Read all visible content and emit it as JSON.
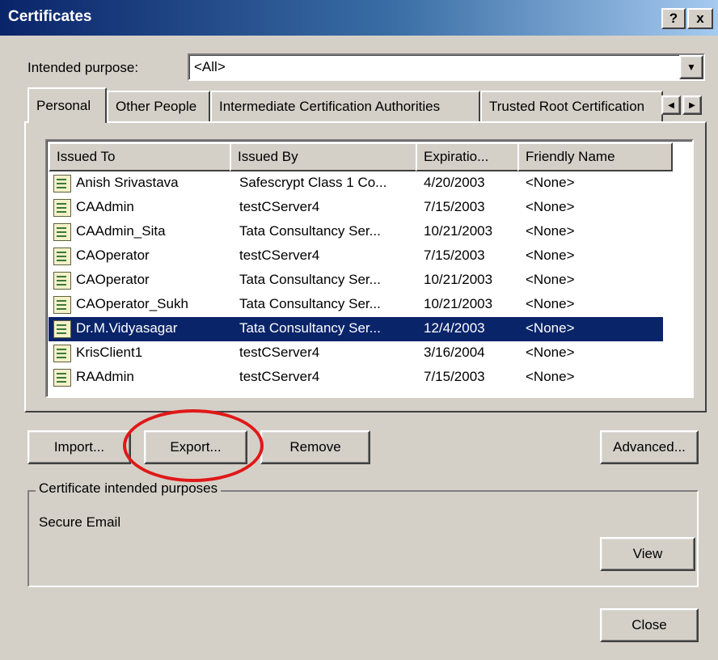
{
  "window": {
    "title": "Certificates",
    "help_button": "?",
    "close_button": "x"
  },
  "purpose": {
    "label": "Intended purpose:",
    "value": "<All>"
  },
  "tabs": [
    {
      "label": "Personal"
    },
    {
      "label": "Other People"
    },
    {
      "label": "Intermediate Certification Authorities"
    },
    {
      "label": "Trusted Root Certification"
    }
  ],
  "list": {
    "columns": [
      "Issued To",
      "Issued By",
      "Expiratio...",
      "Friendly Name"
    ],
    "rows": [
      {
        "issued_to": "Anish Srivastava",
        "issued_by": "Safescrypt Class 1 Co...",
        "expiration": "4/20/2003",
        "friendly_name": "<None>"
      },
      {
        "issued_to": "CAAdmin",
        "issued_by": "testCServer4",
        "expiration": "7/15/2003",
        "friendly_name": "<None>"
      },
      {
        "issued_to": "CAAdmin_Sita",
        "issued_by": "Tata Consultancy Ser...",
        "expiration": "10/21/2003",
        "friendly_name": "<None>"
      },
      {
        "issued_to": "CAOperator",
        "issued_by": "testCServer4",
        "expiration": "7/15/2003",
        "friendly_name": "<None>"
      },
      {
        "issued_to": "CAOperator",
        "issued_by": "Tata Consultancy Ser...",
        "expiration": "10/21/2003",
        "friendly_name": "<None>"
      },
      {
        "issued_to": "CAOperator_Sukh",
        "issued_by": "Tata Consultancy Ser...",
        "expiration": "10/21/2003",
        "friendly_name": "<None>"
      },
      {
        "issued_to": "Dr.M.Vidyasagar",
        "issued_by": "Tata Consultancy Ser...",
        "expiration": "12/4/2003",
        "friendly_name": "<None>",
        "selected": true
      },
      {
        "issued_to": "KrisClient1",
        "issued_by": "testCServer4",
        "expiration": "3/16/2004",
        "friendly_name": "<None>"
      },
      {
        "issued_to": "RAAdmin",
        "issued_by": "testCServer4",
        "expiration": "7/15/2003",
        "friendly_name": "<None>"
      }
    ]
  },
  "buttons": {
    "import": "Import...",
    "export": "Export...",
    "remove": "Remove",
    "advanced": "Advanced...",
    "view": "View",
    "close": "Close"
  },
  "purposes_group": {
    "label": "Certificate intended purposes",
    "value": "Secure Email"
  },
  "colors": {
    "title_gradient_start": "#0a246a",
    "selection": "#0a246a",
    "annotation_oval": "#e01818"
  }
}
